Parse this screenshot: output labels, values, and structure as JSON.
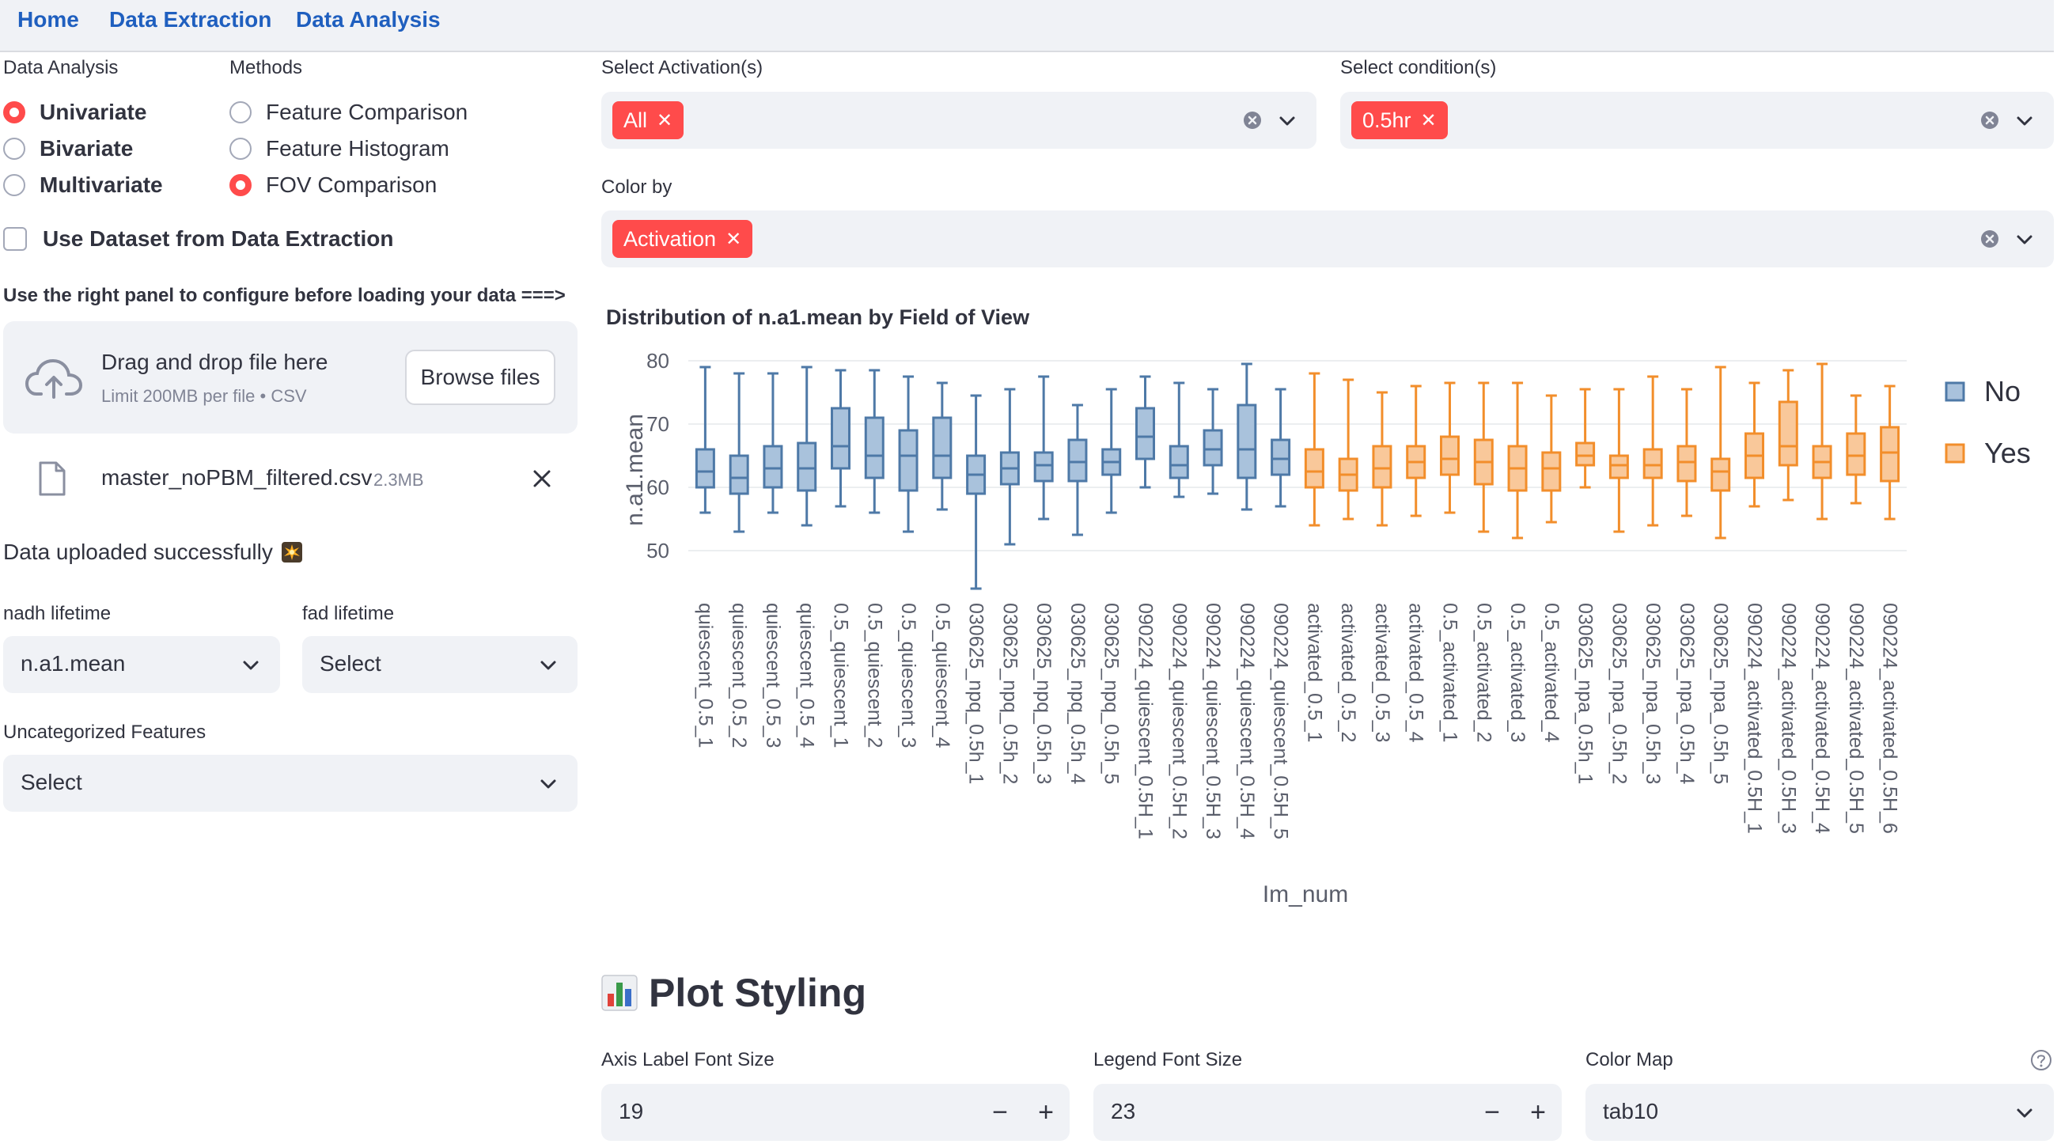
{
  "nav": {
    "home": "Home",
    "extraction": "Data Extraction",
    "analysis": "Data Analysis"
  },
  "sidebar": {
    "data_analysis_label": "Data Analysis",
    "methods_label": "Methods",
    "analysis_options": [
      {
        "label": "Univariate",
        "selected": true
      },
      {
        "label": "Bivariate",
        "selected": false
      },
      {
        "label": "Multivariate",
        "selected": false
      }
    ],
    "method_options": [
      {
        "label": "Feature Comparison",
        "selected": false
      },
      {
        "label": "Feature Histogram",
        "selected": false
      },
      {
        "label": "FOV Comparison",
        "selected": true
      }
    ],
    "use_dataset_label": "Use Dataset from Data Extraction",
    "hint": "Use the right panel to configure before loading your data ===>",
    "uploader": {
      "title": "Drag and drop file here",
      "subtitle": "Limit 200MB per file • CSV",
      "browse": "Browse files"
    },
    "file": {
      "name": "master_noPBM_filtered.csv",
      "size": "2.3MB"
    },
    "success": "Data uploaded successfully",
    "nadh_label": "nadh lifetime",
    "nadh_value": "n.a1.mean",
    "fad_label": "fad lifetime",
    "fad_value": "Select",
    "uncat_label": "Uncategorized Features",
    "uncat_value": "Select"
  },
  "filters": {
    "activation_label": "Select Activation(s)",
    "activation_tag": "All",
    "condition_label": "Select condition(s)",
    "condition_tag": "0.5hr",
    "color_label": "Color by",
    "color_tag": "Activation"
  },
  "chart_data": {
    "type": "box",
    "title": "Distribution of n.a1.mean by Field of View",
    "xlabel": "Im_num",
    "ylabel": "n.a1.mean",
    "yticks": [
      50,
      60,
      70,
      80
    ],
    "ylim": [
      42,
      82
    ],
    "legend": [
      "No",
      "Yes"
    ],
    "colors": {
      "No": "#4e79a7",
      "Yes": "#f28e2b"
    },
    "boxes": [
      {
        "cat": "quiescent_0.5_1",
        "group": "No",
        "min": 56,
        "q1": 60,
        "median": 62.5,
        "q3": 66,
        "max": 79
      },
      {
        "cat": "quiescent_0.5_2",
        "group": "No",
        "min": 53,
        "q1": 59,
        "median": 61.5,
        "q3": 65,
        "max": 78
      },
      {
        "cat": "quiescent_0.5_3",
        "group": "No",
        "min": 56,
        "q1": 60,
        "median": 63,
        "q3": 66.5,
        "max": 78
      },
      {
        "cat": "quiescent_0.5_4",
        "group": "No",
        "min": 54,
        "q1": 59.5,
        "median": 63,
        "q3": 67,
        "max": 79
      },
      {
        "cat": "0.5_quiescent_1",
        "group": "No",
        "min": 57,
        "q1": 63,
        "median": 66.5,
        "q3": 72.5,
        "max": 78.5
      },
      {
        "cat": "0.5_quiescent_2",
        "group": "No",
        "min": 56,
        "q1": 61.5,
        "median": 65,
        "q3": 71,
        "max": 78.5
      },
      {
        "cat": "0.5_quiescent_3",
        "group": "No",
        "min": 53,
        "q1": 59.5,
        "median": 65,
        "q3": 69,
        "max": 77.5
      },
      {
        "cat": "0.5_quiescent_4",
        "group": "No",
        "min": 56.5,
        "q1": 61.5,
        "median": 65,
        "q3": 71,
        "max": 76.5
      },
      {
        "cat": "030625_npq_0.5h_1",
        "group": "No",
        "min": 44,
        "q1": 59,
        "median": 62,
        "q3": 65,
        "max": 74.5
      },
      {
        "cat": "030625_npq_0.5h_2",
        "group": "No",
        "min": 51,
        "q1": 60.5,
        "median": 63,
        "q3": 65.5,
        "max": 75.5
      },
      {
        "cat": "030625_npq_0.5h_3",
        "group": "No",
        "min": 55,
        "q1": 61,
        "median": 63.5,
        "q3": 65.5,
        "max": 77.5
      },
      {
        "cat": "030625_npq_0.5h_4",
        "group": "No",
        "min": 52.5,
        "q1": 61,
        "median": 64,
        "q3": 67.5,
        "max": 73
      },
      {
        "cat": "030625_npq_0.5h_5",
        "group": "No",
        "min": 56,
        "q1": 62,
        "median": 64,
        "q3": 66,
        "max": 75.5
      },
      {
        "cat": "090224_quiescent_0.5H_1",
        "group": "No",
        "min": 60,
        "q1": 64.5,
        "median": 68,
        "q3": 72.5,
        "max": 77.5
      },
      {
        "cat": "090224_quiescent_0.5H_2",
        "group": "No",
        "min": 58.5,
        "q1": 61.5,
        "median": 63.5,
        "q3": 66.5,
        "max": 76.5
      },
      {
        "cat": "090224_quiescent_0.5H_3",
        "group": "No",
        "min": 59,
        "q1": 63.5,
        "median": 66,
        "q3": 69,
        "max": 75.5
      },
      {
        "cat": "090224_quiescent_0.5H_4",
        "group": "No",
        "min": 56.5,
        "q1": 61.5,
        "median": 66,
        "q3": 73,
        "max": 79.5
      },
      {
        "cat": "090224_quiescent_0.5H_5",
        "group": "No",
        "min": 57,
        "q1": 62,
        "median": 64.5,
        "q3": 67.5,
        "max": 75.5
      },
      {
        "cat": "activated_0.5_1",
        "group": "Yes",
        "min": 54,
        "q1": 60,
        "median": 62.5,
        "q3": 66,
        "max": 78
      },
      {
        "cat": "activated_0.5_2",
        "group": "Yes",
        "min": 55,
        "q1": 59.5,
        "median": 62,
        "q3": 64.5,
        "max": 77
      },
      {
        "cat": "activated_0.5_3",
        "group": "Yes",
        "min": 54,
        "q1": 60,
        "median": 63,
        "q3": 66.5,
        "max": 75
      },
      {
        "cat": "activated_0.5_4",
        "group": "Yes",
        "min": 55.5,
        "q1": 61.5,
        "median": 64,
        "q3": 66.5,
        "max": 76
      },
      {
        "cat": "0.5_activated_1",
        "group": "Yes",
        "min": 56,
        "q1": 62,
        "median": 64.5,
        "q3": 68,
        "max": 76.5
      },
      {
        "cat": "0.5_activated_2",
        "group": "Yes",
        "min": 53,
        "q1": 60.5,
        "median": 64,
        "q3": 67.5,
        "max": 76.5
      },
      {
        "cat": "0.5_activated_3",
        "group": "Yes",
        "min": 52,
        "q1": 59.5,
        "median": 63,
        "q3": 66.5,
        "max": 76.5
      },
      {
        "cat": "0.5_activated_4",
        "group": "Yes",
        "min": 54.5,
        "q1": 59.5,
        "median": 63,
        "q3": 65.5,
        "max": 74.5
      },
      {
        "cat": "030625_npa_0.5h_1",
        "group": "Yes",
        "min": 60,
        "q1": 63.5,
        "median": 65,
        "q3": 67,
        "max": 75.5
      },
      {
        "cat": "030625_npa_0.5h_2",
        "group": "Yes",
        "min": 53,
        "q1": 61.5,
        "median": 63.5,
        "q3": 65,
        "max": 75.5
      },
      {
        "cat": "030625_npa_0.5h_3",
        "group": "Yes",
        "min": 54,
        "q1": 61.5,
        "median": 63.5,
        "q3": 66,
        "max": 77.5
      },
      {
        "cat": "030625_npa_0.5h_4",
        "group": "Yes",
        "min": 55.5,
        "q1": 61,
        "median": 64,
        "q3": 66.5,
        "max": 75.5
      },
      {
        "cat": "030625_npa_0.5h_5",
        "group": "Yes",
        "min": 52,
        "q1": 59.5,
        "median": 62.5,
        "q3": 64.5,
        "max": 79
      },
      {
        "cat": "090224_activated_0.5H_1",
        "group": "Yes",
        "min": 57,
        "q1": 61.5,
        "median": 65,
        "q3": 68.5,
        "max": 76.5
      },
      {
        "cat": "090224_activated_0.5H_3",
        "group": "Yes",
        "min": 58,
        "q1": 63.5,
        "median": 66.5,
        "q3": 73.5,
        "max": 78.5
      },
      {
        "cat": "090224_activated_0.5H_4",
        "group": "Yes",
        "min": 55,
        "q1": 61.5,
        "median": 64,
        "q3": 66.5,
        "max": 79.5
      },
      {
        "cat": "090224_activated_0.5H_5",
        "group": "Yes",
        "min": 57.5,
        "q1": 62,
        "median": 65,
        "q3": 68.5,
        "max": 74.5
      },
      {
        "cat": "090224_activated_0.5H_6",
        "group": "Yes",
        "min": 55,
        "q1": 61,
        "median": 65.5,
        "q3": 69.5,
        "max": 76
      }
    ]
  },
  "styling": {
    "title": "Plot Styling",
    "axis_font_label": "Axis Label Font Size",
    "axis_font_value": "19",
    "legend_font_label": "Legend Font Size",
    "legend_font_value": "23",
    "cmap_label": "Color Map",
    "cmap_value": "tab10"
  }
}
